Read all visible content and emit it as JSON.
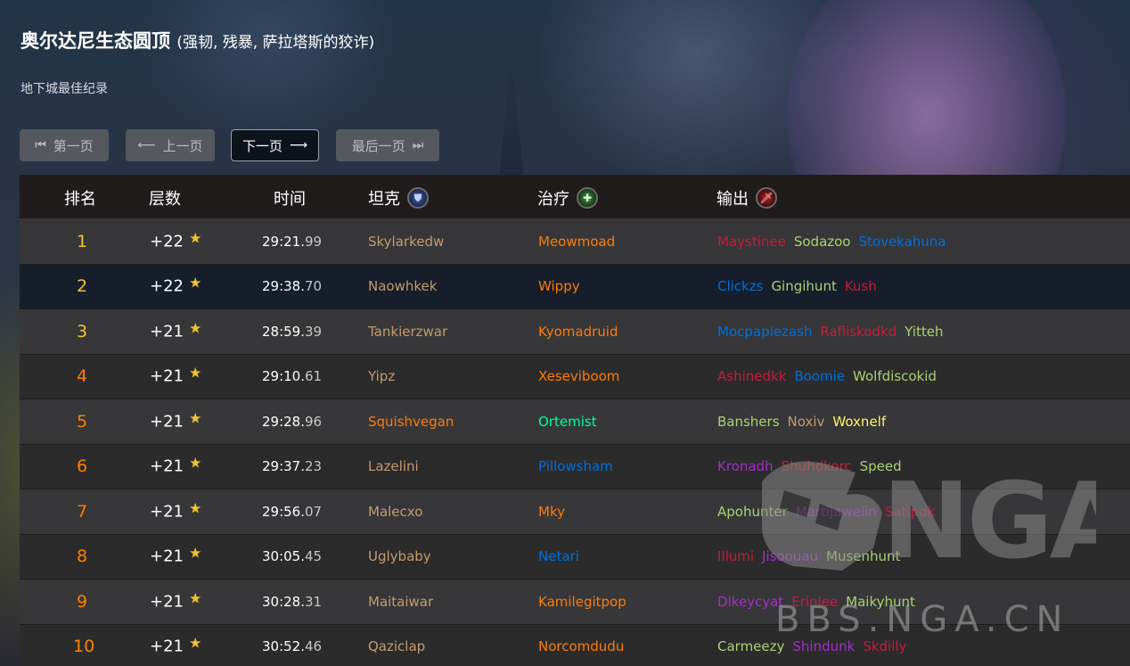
{
  "header": {
    "title": "奥尔达尼生态圆顶",
    "affixes": "(强韧, 残暴, 萨拉塔斯的狡诈)",
    "subtitle": "地下城最佳纪录"
  },
  "pager": {
    "first": "第一页",
    "prev": "上一页",
    "next": "下一页",
    "last": "最后一页"
  },
  "columns": {
    "rank": "排名",
    "level": "层数",
    "time": "时间",
    "tank": "坦克",
    "healer": "治疗",
    "dps": "输出"
  },
  "colors": {
    "rank_top": "#f2c230",
    "rank_other": "#ff8000",
    "warrior": "#c69b6d",
    "druid": "#ff7c0a",
    "demon_hunter": "#a330c9",
    "paladin": "#f48cba",
    "monk": "#00ff98",
    "shaman": "#0070dd",
    "priest": "#ffffff",
    "mage": "#3fc7eb",
    "hunter": "#aad372",
    "rogue": "#fff468",
    "warlock": "#8788ee",
    "death_knight": "#c41e3a",
    "evoker": "#33937f"
  },
  "rows": [
    {
      "rank": "1",
      "level": "+22",
      "time_main": "29:21.",
      "time_ms": "99",
      "tank": {
        "name": "Skylarkedw",
        "color": "#c69b6d"
      },
      "healer": {
        "name": "Meowmoad",
        "color": "#ff7c0a"
      },
      "dps": [
        {
          "name": "Maystinee",
          "color": "#c41e3a"
        },
        {
          "name": "Sodazoo",
          "color": "#aad372"
        },
        {
          "name": "Stovekahuna",
          "color": "#0070dd"
        }
      ]
    },
    {
      "rank": "2",
      "level": "+22",
      "time_main": "29:38.",
      "time_ms": "70",
      "tank": {
        "name": "Naowhkek",
        "color": "#c69b6d"
      },
      "healer": {
        "name": "Wippy",
        "color": "#ff7c0a"
      },
      "dps": [
        {
          "name": "Clickzs",
          "color": "#0070dd"
        },
        {
          "name": "Gingihunt",
          "color": "#aad372"
        },
        {
          "name": "Kush",
          "color": "#c41e3a"
        }
      ]
    },
    {
      "rank": "3",
      "level": "+21",
      "time_main": "28:59.",
      "time_ms": "39",
      "tank": {
        "name": "Tankierzwar",
        "color": "#c69b6d"
      },
      "healer": {
        "name": "Kyomadruid",
        "color": "#ff7c0a"
      },
      "dps": [
        {
          "name": "Mocpapiezash",
          "color": "#0070dd"
        },
        {
          "name": "Rafliskodkd",
          "color": "#c41e3a"
        },
        {
          "name": "Yitteh",
          "color": "#aad372"
        }
      ]
    },
    {
      "rank": "4",
      "level": "+21",
      "time_main": "29:10.",
      "time_ms": "61",
      "tank": {
        "name": "Yipz",
        "color": "#c69b6d"
      },
      "healer": {
        "name": "Xeseviboom",
        "color": "#ff7c0a"
      },
      "dps": [
        {
          "name": "Ashinedkk",
          "color": "#c41e3a"
        },
        {
          "name": "Boomie",
          "color": "#0070dd"
        },
        {
          "name": "Wolfdiscokid",
          "color": "#aad372"
        }
      ]
    },
    {
      "rank": "5",
      "level": "+21",
      "time_main": "29:28.",
      "time_ms": "96",
      "tank": {
        "name": "Squishvegan",
        "color": "#ff7c0a"
      },
      "healer": {
        "name": "Ortemist",
        "color": "#00ff98"
      },
      "dps": [
        {
          "name": "Banshers",
          "color": "#aad372"
        },
        {
          "name": "Noxiv",
          "color": "#c69b6d"
        },
        {
          "name": "Woxnelf",
          "color": "#fff468"
        }
      ]
    },
    {
      "rank": "6",
      "level": "+21",
      "time_main": "29:37.",
      "time_ms": "23",
      "tank": {
        "name": "Lazelini",
        "color": "#c69b6d"
      },
      "healer": {
        "name": "Pillowsham",
        "color": "#0070dd"
      },
      "dps": [
        {
          "name": "Kronadh",
          "color": "#a330c9"
        },
        {
          "name": "Shuhdkorc",
          "color": "#c41e3a"
        },
        {
          "name": "Speed",
          "color": "#aad372"
        }
      ]
    },
    {
      "rank": "7",
      "level": "+21",
      "time_main": "29:56.",
      "time_ms": "07",
      "tank": {
        "name": "Malecxo",
        "color": "#c69b6d"
      },
      "healer": {
        "name": "Mky",
        "color": "#ff7c0a"
      },
      "dps": [
        {
          "name": "Apohunter",
          "color": "#aad372"
        },
        {
          "name": "Martijawelin",
          "color": "#a330c9"
        },
        {
          "name": "Satipdk",
          "color": "#c41e3a"
        }
      ]
    },
    {
      "rank": "8",
      "level": "+21",
      "time_main": "30:05.",
      "time_ms": "45",
      "tank": {
        "name": "Uglybaby",
        "color": "#c69b6d"
      },
      "healer": {
        "name": "Netari",
        "color": "#0070dd"
      },
      "dps": [
        {
          "name": "Illumi",
          "color": "#c41e3a"
        },
        {
          "name": "Jisoouau",
          "color": "#a330c9"
        },
        {
          "name": "Musenhunt",
          "color": "#aad372"
        }
      ]
    },
    {
      "rank": "9",
      "level": "+21",
      "time_main": "30:28.",
      "time_ms": "31",
      "tank": {
        "name": "Maitaiwar",
        "color": "#c69b6d"
      },
      "healer": {
        "name": "Kamilegitpop",
        "color": "#ff7c0a"
      },
      "dps": [
        {
          "name": "Dlkeycyat",
          "color": "#a330c9"
        },
        {
          "name": "Erinlee",
          "color": "#c41e3a"
        },
        {
          "name": "Maikyhunt",
          "color": "#aad372"
        }
      ]
    },
    {
      "rank": "10",
      "level": "+21",
      "time_main": "30:52.",
      "time_ms": "46",
      "tank": {
        "name": "Qaziclap",
        "color": "#c69b6d"
      },
      "healer": {
        "name": "Norcomdudu",
        "color": "#ff7c0a"
      },
      "dps": [
        {
          "name": "Carmeezy",
          "color": "#aad372"
        },
        {
          "name": "Shindunk",
          "color": "#a330c9"
        },
        {
          "name": "Skdilly",
          "color": "#c41e3a"
        }
      ]
    }
  ],
  "watermark": {
    "logo": "NGA",
    "url": "BBS.NGA.CN"
  }
}
